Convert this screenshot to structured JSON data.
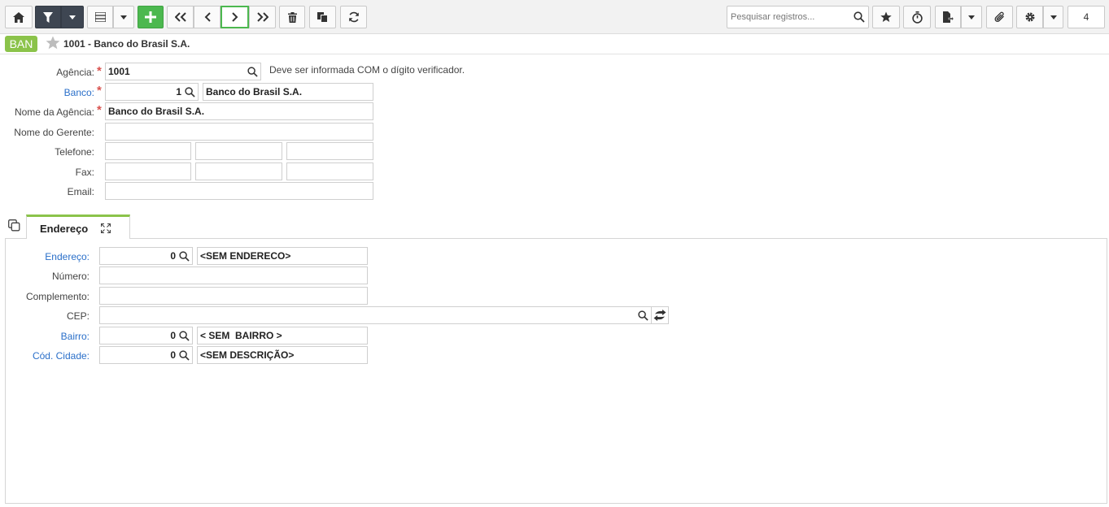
{
  "toolbar": {
    "buttons": [
      {
        "name": "home",
        "icon": "home-icon"
      },
      {
        "name": "filter",
        "icon": "filter-icon"
      },
      {
        "name": "list",
        "icon": "list-icon"
      },
      {
        "name": "add",
        "icon": "plus-icon"
      },
      {
        "name": "first",
        "icon": "double-chevron-left-icon"
      },
      {
        "name": "previous",
        "icon": "chevron-left-icon"
      },
      {
        "name": "next",
        "icon": "chevron-right-icon"
      },
      {
        "name": "last",
        "icon": "double-chevron-right-icon"
      },
      {
        "name": "delete",
        "icon": "trash-icon"
      },
      {
        "name": "copy",
        "icon": "copy-icon"
      },
      {
        "name": "refresh",
        "icon": "refresh-icon"
      },
      {
        "name": "favorite",
        "icon": "star-icon"
      },
      {
        "name": "timer",
        "icon": "stopwatch-icon"
      },
      {
        "name": "export",
        "icon": "file-export-icon"
      },
      {
        "name": "attach",
        "icon": "paperclip-icon"
      },
      {
        "name": "settings",
        "icon": "gear-icon"
      }
    ],
    "search_placeholder": "Pesquisar registros...",
    "record_count": "4"
  },
  "header": {
    "badge": "BAN",
    "title": "1001 - Banco do Brasil S.A."
  },
  "form": {
    "agencia": {
      "label": "Agência:",
      "value": "1001",
      "required": true
    },
    "agencia_hint": "Deve ser informada COM o dígito verificador.",
    "banco": {
      "label": "Banco:",
      "code": "1",
      "name": "Banco do Brasil S.A.",
      "required": true
    },
    "nome_agencia": {
      "label": "Nome da Agência:",
      "value": "Banco do Brasil S.A.",
      "required": true
    },
    "nome_gerente": {
      "label": "Nome do Gerente:",
      "value": ""
    },
    "telefone": {
      "label": "Telefone:",
      "values": [
        "",
        "",
        ""
      ]
    },
    "fax": {
      "label": "Fax:",
      "values": [
        "",
        "",
        ""
      ]
    },
    "email": {
      "label": "Email:",
      "value": ""
    }
  },
  "tabs": [
    {
      "label": "Endereço",
      "active": true
    }
  ],
  "endereco": {
    "endereco": {
      "label": "Endereço:",
      "code": "0",
      "desc": "<SEM ENDERECO>"
    },
    "numero": {
      "label": "Número:",
      "value": ""
    },
    "complemento": {
      "label": "Complemento:",
      "value": ""
    },
    "cep": {
      "label": "CEP:",
      "value": ""
    },
    "bairro": {
      "label": "Bairro:",
      "code": "0",
      "desc": "< SEM  BAIRRO >"
    },
    "cidade": {
      "label": "Cód. Cidade:",
      "code": "0",
      "desc": "<SEM DESCRIÇÃO>"
    }
  },
  "colors": {
    "accent_green": "#4cb84f",
    "badge_green": "#8bc34a",
    "link_blue": "#2a6fc9",
    "required_red": "#d9534f",
    "filter_dark": "#3e4652"
  }
}
